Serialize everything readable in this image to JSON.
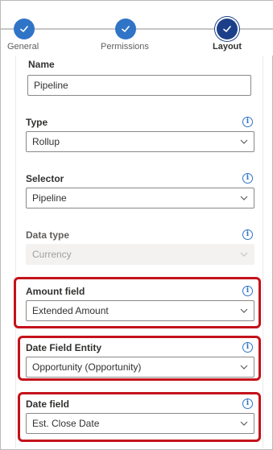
{
  "stepper": {
    "steps": [
      {
        "label": "General",
        "state": "done"
      },
      {
        "label": "Permissions",
        "state": "done"
      },
      {
        "label": "Layout",
        "state": "active"
      }
    ]
  },
  "form": {
    "name": {
      "label": "Name",
      "value": "Pipeline"
    },
    "type": {
      "label": "Type",
      "value": "Rollup"
    },
    "selector": {
      "label": "Selector",
      "value": "Pipeline"
    },
    "data_type": {
      "label": "Data type",
      "value": "Currency",
      "disabled": true
    },
    "amount_field": {
      "label": "Amount field",
      "value": "Extended Amount",
      "highlighted": true
    },
    "date_field_entity": {
      "label": "Date Field Entity",
      "value": "Opportunity (Opportunity)",
      "highlighted": true
    },
    "date_field": {
      "label": "Date field",
      "value": "Est. Close Date",
      "highlighted": true
    }
  },
  "icons": {
    "info": "info-icon",
    "chevron": "chevron-down-icon",
    "check": "checkmark-icon"
  },
  "colors": {
    "step_done": "#2f74c7",
    "step_active": "#1c3f8a",
    "highlight": "#c4121b",
    "info": "#2f74c7"
  }
}
